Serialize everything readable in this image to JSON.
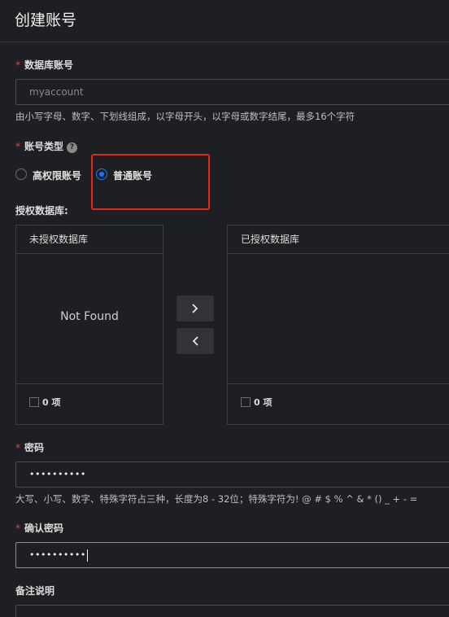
{
  "header": {
    "title": "创建账号"
  },
  "fields": {
    "db_account": {
      "label": "数据库账号",
      "value": "myaccount",
      "hint": "由小写字母、数字、下划线组成，以字母开头，以字母或数字结尾，最多16个字符"
    },
    "account_type": {
      "label": "账号类型",
      "help_icon": "?",
      "options": [
        {
          "label": "高权限账号",
          "selected": false
        },
        {
          "label": "普通账号",
          "selected": true
        }
      ]
    },
    "authorized_db": {
      "label": "授权数据库:",
      "left_panel": {
        "title": "未授权数据库",
        "empty_text": "Not Found",
        "count": "0 项"
      },
      "right_panel": {
        "title": "已授权数据库",
        "count": "0 项"
      },
      "move_right_icon": "chevron-right-icon",
      "move_left_icon": "chevron-left-icon"
    },
    "password": {
      "label": "密码",
      "masked_value": "••••••••••",
      "hint": "大写、小写、数字、特殊字符占三种，长度为8 - 32位；特殊字符为! @ # $ % ^ & * () _ + - ="
    },
    "confirm_password": {
      "label": "确认密码",
      "masked_value": "••••••••••"
    },
    "remark": {
      "label": "备注说明"
    }
  },
  "required_mark": "*",
  "colors": {
    "background": "#1e1f22",
    "required": "#e0483e",
    "radio_selected": "#1677ff",
    "highlight_box": "#e3261c"
  }
}
